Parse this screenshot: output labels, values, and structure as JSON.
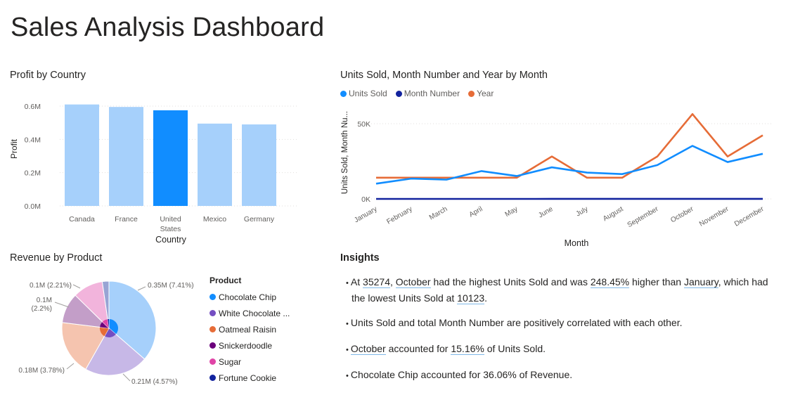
{
  "dashboard": {
    "title": "Sales Analysis Dashboard"
  },
  "profit_chart": {
    "title": "Profit by Country",
    "chart_data": {
      "type": "bar",
      "categories": [
        "Canada",
        "France",
        "United States",
        "Mexico",
        "Germany"
      ],
      "category_labels": [
        [
          "Canada"
        ],
        [
          "France"
        ],
        [
          "United",
          "States"
        ],
        [
          "Mexico"
        ],
        [
          "Germany"
        ]
      ],
      "values": [
        0.61,
        0.595,
        0.575,
        0.495,
        0.49
      ],
      "xlabel": "Country",
      "ylabel": "Profit",
      "yticks": [
        "0.0M",
        "0.2M",
        "0.4M",
        "0.6M"
      ],
      "ylim": [
        0,
        0.6
      ],
      "highlighted": "United States",
      "colors": {
        "default": "#a6d0fb",
        "highlight": "#118dff"
      }
    }
  },
  "line_chart": {
    "title": "Units Sold, Month Number and Year by Month",
    "chart_data": {
      "type": "line",
      "x": [
        "January",
        "February",
        "March",
        "April",
        "May",
        "June",
        "July",
        "August",
        "September",
        "October",
        "November",
        "December"
      ],
      "series": [
        {
          "name": "Units Sold",
          "color": "#118dff",
          "values": [
            10123,
            13500,
            12800,
            18500,
            15200,
            21000,
            17500,
            16500,
            22500,
            35274,
            24500,
            30000
          ]
        },
        {
          "name": "Month Number",
          "color": "#12239e",
          "values": [
            1,
            2,
            3,
            4,
            5,
            6,
            7,
            8,
            9,
            10,
            11,
            12
          ]
        },
        {
          "name": "Year",
          "color": "#e66c37",
          "values": [
            14100,
            14100,
            14100,
            14100,
            14100,
            28200,
            14100,
            14100,
            28200,
            56400,
            28200,
            42300
          ]
        }
      ],
      "xlabel": "Month",
      "ylabel": "Units Sold, Month Nu...",
      "yticks": [
        "0K",
        "50K"
      ],
      "ylim": [
        0,
        60000
      ]
    }
  },
  "pie_chart": {
    "title": "Revenue by Product",
    "legend_title": "Product",
    "chart_data": {
      "type": "pie",
      "categories": [
        "Chocolate Chip",
        "White Chocolate ...",
        "Oatmeal Raisin",
        "Snickerdoodle",
        "Sugar",
        "Fortune Cookie"
      ],
      "outer_values": [
        0.35,
        0.21,
        0.18,
        0.1,
        0.1,
        0.022
      ],
      "outer_labels": [
        "0.35M (7.41%)",
        "0.21M (4.57%)",
        "0.18M (3.78%)",
        "0.1M (2.2%)",
        "0.1M (2.21%)",
        ""
      ],
      "colors": [
        "#118dff",
        "#744ec2",
        "#e66c37",
        "#6b007b",
        "#e044a7",
        "#12239e"
      ],
      "light_colors": [
        "#a6d0fb",
        "#c7b8e7",
        "#f5c4af",
        "#c39ec8",
        "#f2b4dc",
        "#98a4d4"
      ]
    }
  },
  "insights": {
    "title": "Insights",
    "items": [
      [
        "At ",
        "35274",
        ", ",
        "October",
        " had the highest Units Sold and was ",
        "248.45%",
        " higher than ",
        "January",
        ", which had the lowest Units Sold at ",
        "10123",
        "."
      ],
      [
        "Units Sold and total Month Number are positively correlated with each other."
      ],
      [
        "",
        "October",
        " accounted for ",
        "15.16%",
        " of Units Sold."
      ],
      [
        "Chocolate Chip accounted for 36.06% of Revenue."
      ]
    ]
  }
}
